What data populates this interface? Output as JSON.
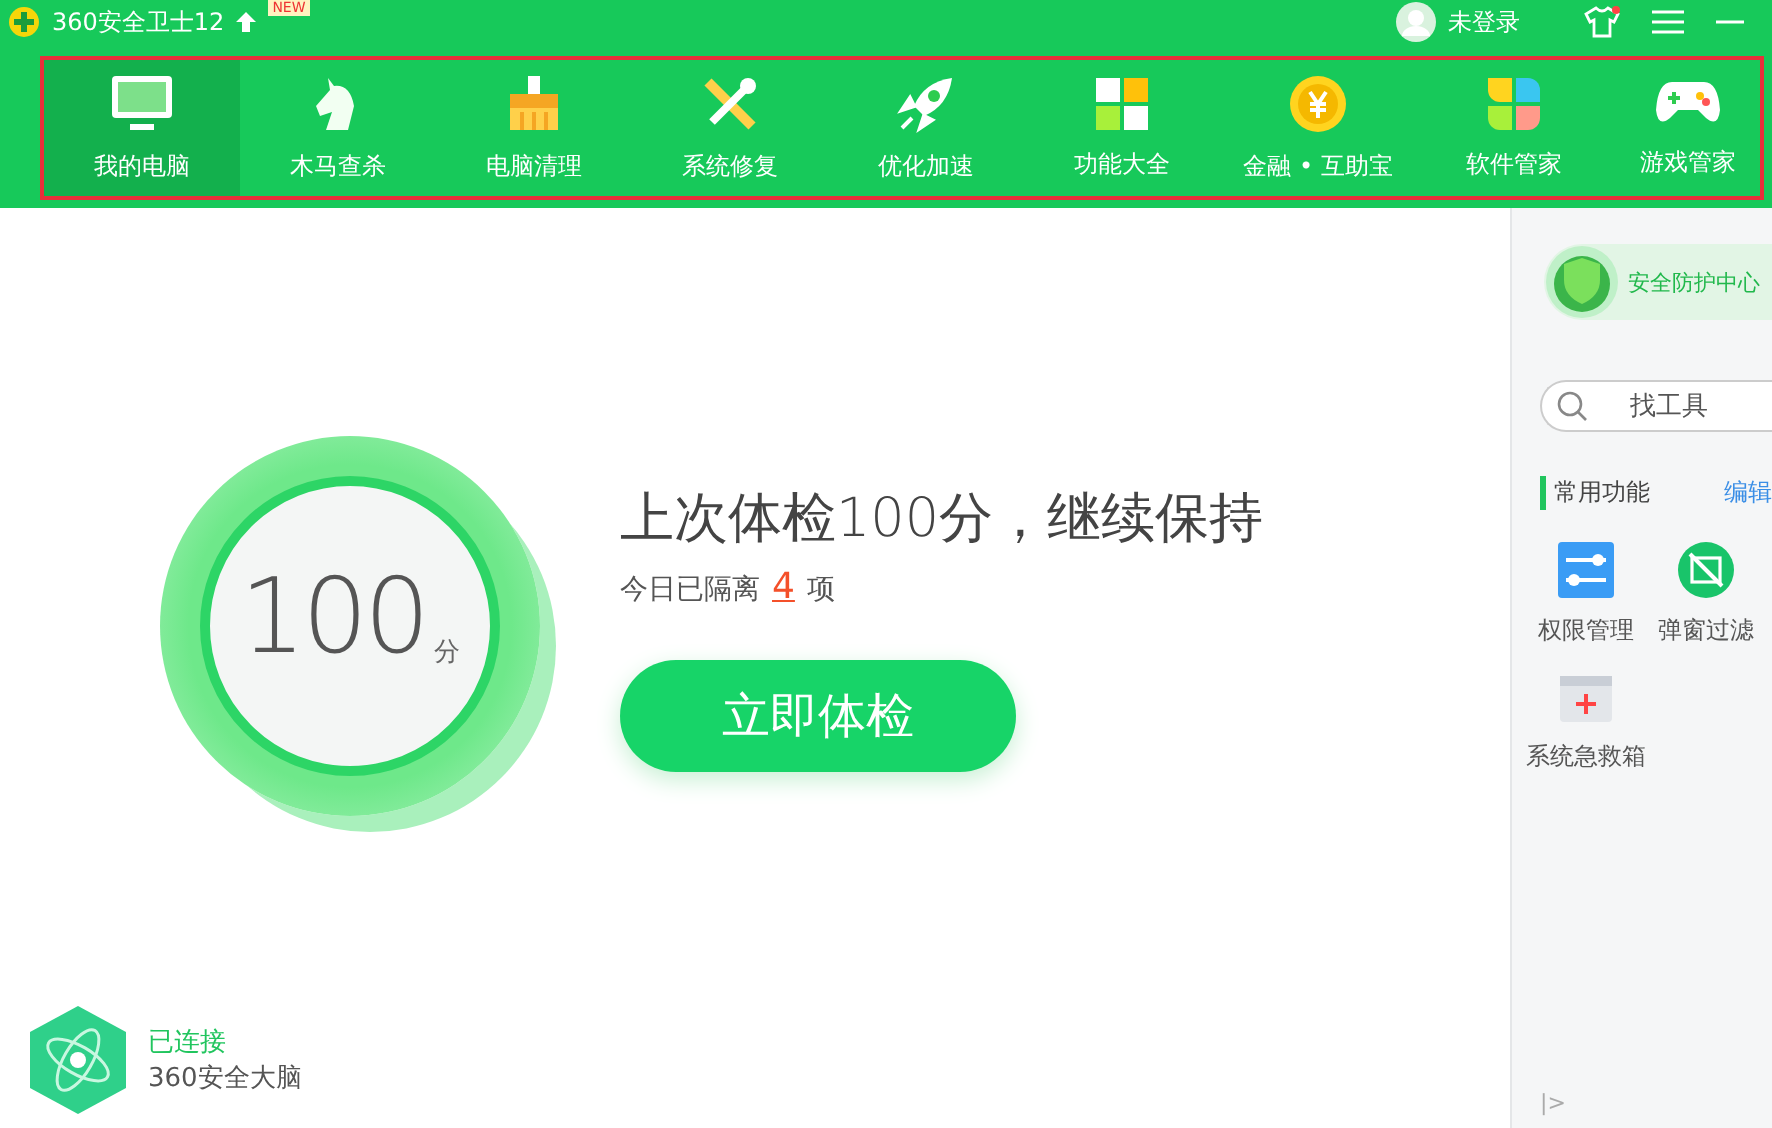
{
  "titlebar": {
    "title": "360安全卫士12",
    "badge": "NEW",
    "user": "未登录"
  },
  "nav": [
    {
      "label": "我的电脑",
      "kind": "monitor",
      "selected": true
    },
    {
      "label": "木马查杀",
      "kind": "horse",
      "selected": false
    },
    {
      "label": "电脑清理",
      "kind": "broom",
      "selected": false
    },
    {
      "label": "系统修复",
      "kind": "tools",
      "selected": false
    },
    {
      "label": "优化加速",
      "kind": "rocket",
      "selected": false
    },
    {
      "label": "功能大全",
      "kind": "grid",
      "selected": false
    },
    {
      "label": "金融 • 互助宝",
      "kind": "coin",
      "selected": false
    },
    {
      "label": "软件管家",
      "kind": "petals",
      "selected": false
    },
    {
      "label": "游戏管家",
      "kind": "gamepad",
      "selected": false
    }
  ],
  "score": {
    "value": "100",
    "unit": "分"
  },
  "headline": "上次体检100分，继续保持",
  "isolated": {
    "prefix": "今日已隔离",
    "count": "4",
    "suffix": "项"
  },
  "check_button": "立即体检",
  "brain": {
    "status": "已连接",
    "name": "360安全大脑"
  },
  "sidebar": {
    "protection": "安全防护中心",
    "search": {
      "placeholder": "找工具"
    },
    "section": "常用功能",
    "edit": "编辑",
    "tools": [
      {
        "label": "权限管理",
        "kind": "switches"
      },
      {
        "label": "弹窗过滤",
        "kind": "popup"
      },
      {
        "label": "系统急救箱",
        "kind": "kit"
      }
    ],
    "collapse": "|>"
  }
}
